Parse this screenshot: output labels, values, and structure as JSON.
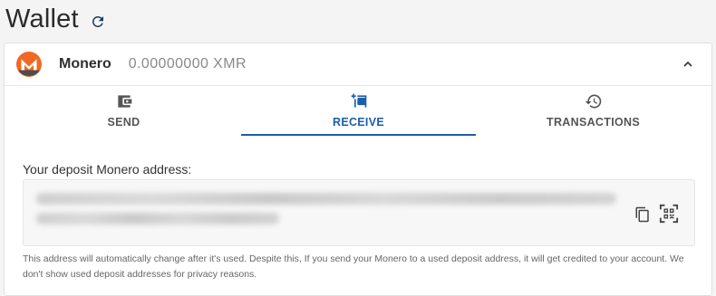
{
  "page": {
    "title": "Wallet"
  },
  "wallet": {
    "coin_name": "Monero",
    "balance": "0.00000000 XMR",
    "brand_color": "#f26822"
  },
  "tabs": [
    {
      "label": "SEND",
      "icon": "wallet-send-icon",
      "active": false
    },
    {
      "label": "RECEIVE",
      "icon": "wallet-receive-icon",
      "active": true
    },
    {
      "label": "TRANSACTIONS",
      "icon": "history-icon",
      "active": false
    }
  ],
  "deposit": {
    "label": "Your deposit Monero address:",
    "info": "This address will automatically change after it's used. Despite this, If you send your Monero to a used deposit address, it will get credited to your account. We don't show used deposit addresses for privacy reasons."
  },
  "colors": {
    "accent": "#1c5fa8",
    "text": "#333333",
    "muted": "#8a8a8a"
  }
}
